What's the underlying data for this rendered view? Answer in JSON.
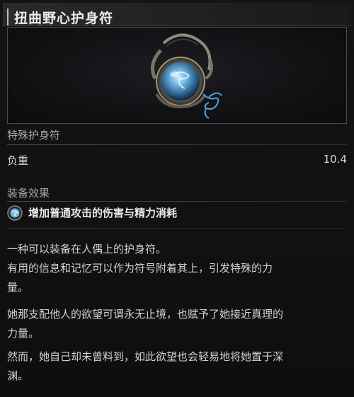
{
  "item": {
    "name": "扭曲野心护身符",
    "category": "特殊护身符",
    "weight_label": "负重",
    "weight_value": "10.4"
  },
  "effect": {
    "header": "装备效果",
    "icon": "talisman-effect-icon",
    "text": "增加普通攻击的伤害与精力消耗"
  },
  "description": {
    "p1_line1": "一种可以装备在人偶上的护身符。",
    "p1_line2": "有用的信息和记忆可以作为符号附着其上，引发特殊的力",
    "p1_line3": "量。",
    "p2_line1": "她那支配他人的欲望可谓永无止境，也赋予了她接近真理的",
    "p2_line2": "力量。",
    "p3_line1": "然而，她自己却未曾料到，如此欲望也会轻易地将她置于深",
    "p3_line2": "渊。"
  },
  "colors": {
    "gem_blue": "#6fb3e0",
    "cord_blue": "#4aa6d6",
    "frame_bronze": "#8f8a78"
  }
}
